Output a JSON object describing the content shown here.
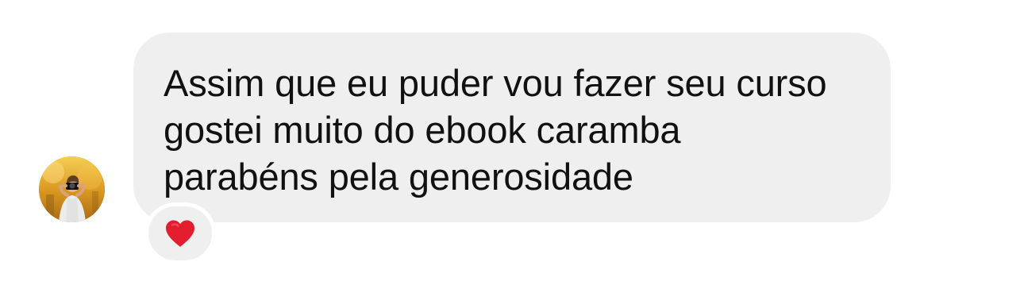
{
  "message": {
    "text": "Assim que eu puder vou fazer seu curso\ngostei muito do ebook caramba\nparabéns pela generosidade"
  },
  "reaction": {
    "emoji": "heart-icon",
    "color": "#e11d2e"
  },
  "avatar": {
    "icon": "photographer-avatar-icon"
  },
  "colors": {
    "bubble": "#efefef",
    "text": "#111111",
    "background": "#ffffff"
  }
}
